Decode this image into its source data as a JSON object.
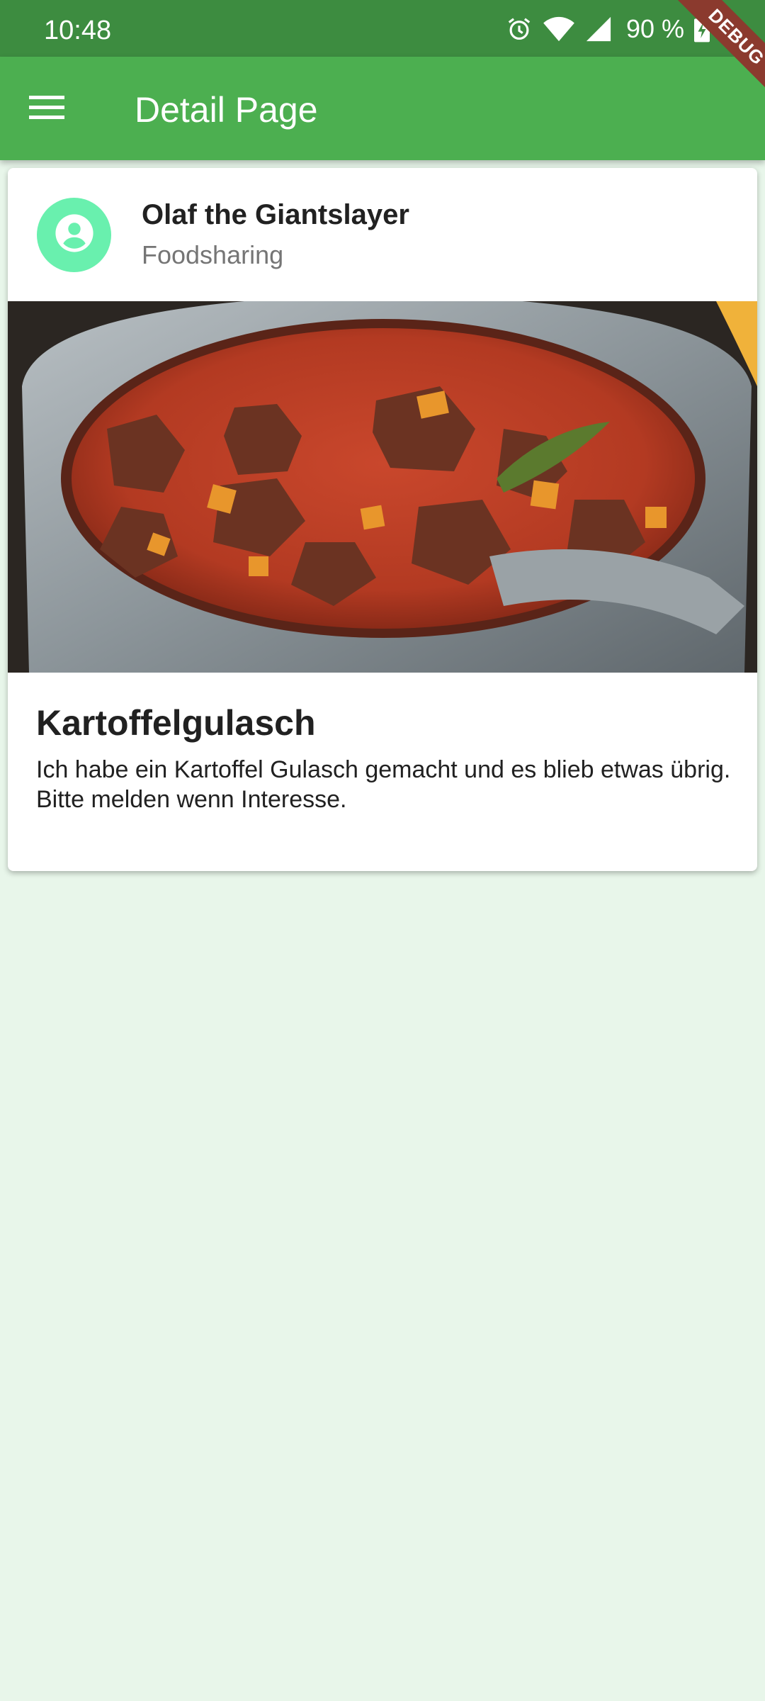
{
  "status_bar": {
    "time": "10:48",
    "battery": "90 %",
    "icons": [
      "alarm-icon",
      "wifi-icon",
      "signal-icon",
      "battery-charging-icon"
    ]
  },
  "debug_banner": "DEBUG",
  "app_bar": {
    "title": "Detail Page",
    "menu_icon": "menu-icon"
  },
  "card": {
    "user_name": "Olaf the Giantslayer",
    "user_subtitle": "Foodsharing",
    "avatar_icon": "account-circle-icon",
    "food_title": "Kartoffelgulasch",
    "food_description": "Ich habe ein Kartoffel Gulasch gemacht und es blieb etwas übrig. Bitte melden wenn Interesse."
  },
  "colors": {
    "status_bar": "#3d8c40",
    "app_bar": "#4caf50",
    "background": "#e8f6ea",
    "avatar": "#69f0ae",
    "debug_ribbon": "#8b3a2e"
  }
}
